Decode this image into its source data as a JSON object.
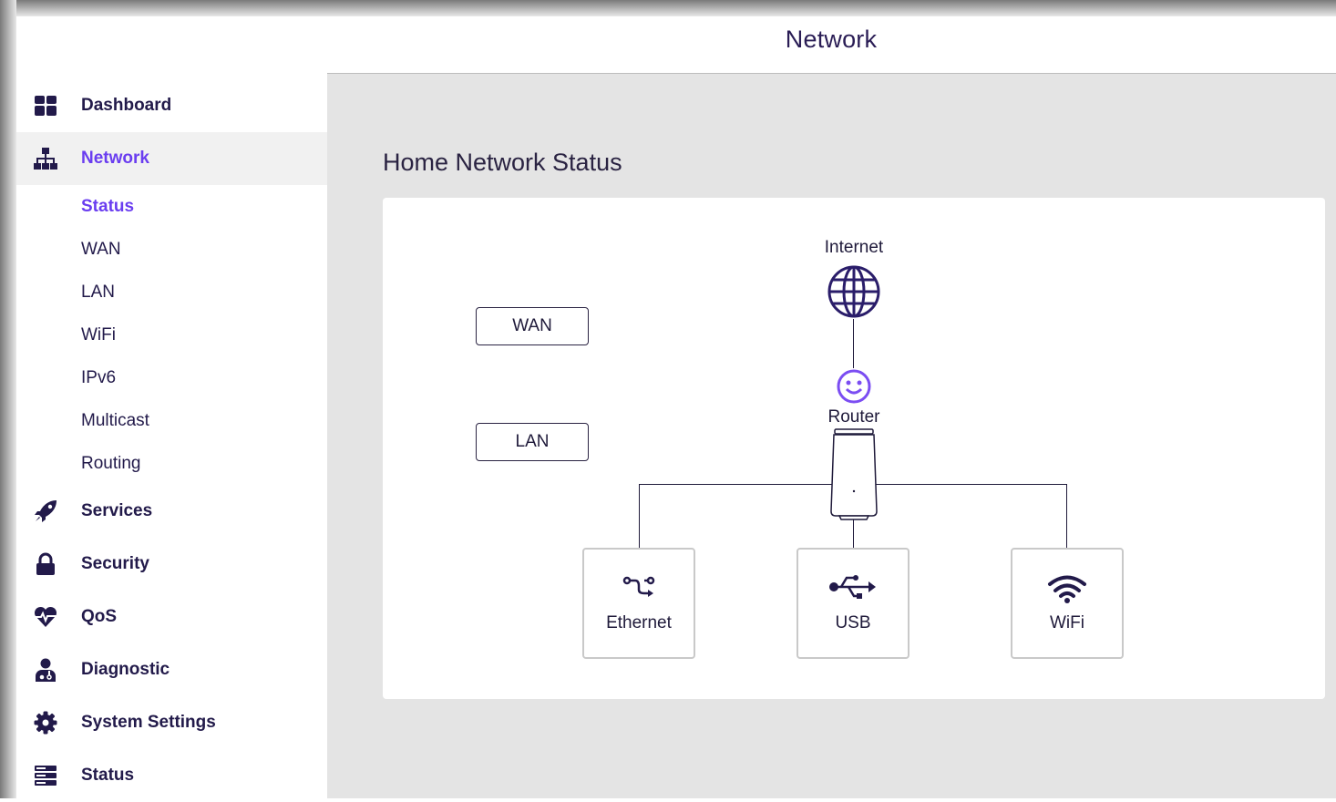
{
  "header": {
    "title": "Network"
  },
  "colors": {
    "accent": "#6a3df0",
    "text": "#221a4a",
    "active_bg": "#f1f1f1",
    "main_bg": "#e4e4e4"
  },
  "sidebar": {
    "items": [
      {
        "label": "Dashboard",
        "icon": "dashboard-icon"
      },
      {
        "label": "Network",
        "icon": "network-icon",
        "active": true
      },
      {
        "label": "Services",
        "icon": "rocket-icon"
      },
      {
        "label": "Security",
        "icon": "lock-icon"
      },
      {
        "label": "QoS",
        "icon": "heart-pulse-icon"
      },
      {
        "label": "Diagnostic",
        "icon": "doctor-icon"
      },
      {
        "label": "System Settings",
        "icon": "gear-icon"
      },
      {
        "label": "Status",
        "icon": "server-icon"
      }
    ],
    "network_sub": [
      {
        "label": "Status",
        "active": true
      },
      {
        "label": "WAN"
      },
      {
        "label": "LAN"
      },
      {
        "label": "WiFi"
      },
      {
        "label": "IPv6"
      },
      {
        "label": "Multicast"
      },
      {
        "label": "Routing"
      }
    ]
  },
  "main": {
    "title": "Home Network Status",
    "buttons": {
      "wan": "WAN",
      "lan": "LAN"
    },
    "diagram": {
      "internet_label": "Internet",
      "router_label": "Router",
      "devices": [
        {
          "label": "Ethernet",
          "icon": "ethernet-icon"
        },
        {
          "label": "USB",
          "icon": "usb-icon"
        },
        {
          "label": "WiFi",
          "icon": "wifi-icon"
        }
      ]
    }
  }
}
